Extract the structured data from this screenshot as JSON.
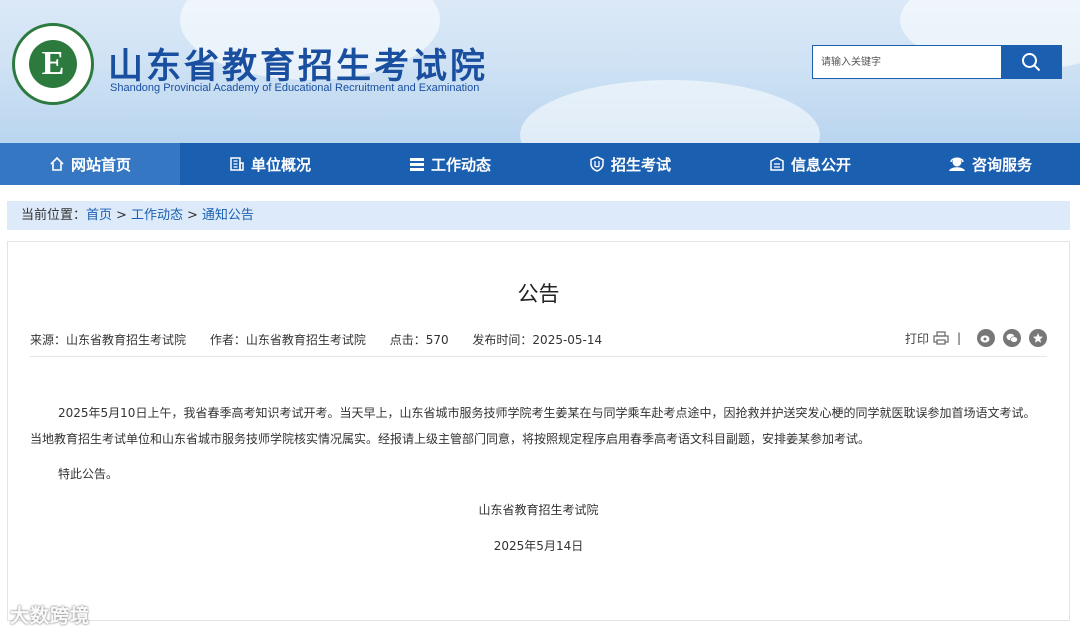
{
  "header": {
    "logo_letter": "E",
    "title": "山东省教育招生考试院",
    "subtitle": "Shandong Provincial Academy of Educational Recruitment and Examination",
    "search_placeholder": "请输入关键字",
    "search_icon": "search-icon"
  },
  "nav": {
    "items": [
      {
        "label": "网站首页",
        "icon": "home-icon",
        "active": true
      },
      {
        "label": "单位概况",
        "icon": "building-icon"
      },
      {
        "label": "工作动态",
        "icon": "list-icon"
      },
      {
        "label": "招生考试",
        "icon": "shield-icon"
      },
      {
        "label": "信息公开",
        "icon": "info-board-icon"
      },
      {
        "label": "咨询服务",
        "icon": "support-icon"
      }
    ]
  },
  "breadcrumb": {
    "prefix": "当前位置：",
    "items": [
      "首页",
      "工作动态",
      "通知公告"
    ],
    "separator": ">"
  },
  "article": {
    "title": "公告",
    "meta": {
      "source": "来源：山东省教育招生考试院",
      "author": "作者：山东省教育招生考试院",
      "clicks": "点击：570",
      "date": "发布时间：2025-05-14"
    },
    "tools": {
      "print": "打印",
      "separator": "|"
    },
    "paragraph1": "2025年5月10日上午，我省春季高考知识考试开考。当天早上，山东省城市服务技师学院考生姜某在与同学乘车赴考点途中，因抢救并护送突发心梗的同学就医耽误参加首场语文考试。当地教育招生考试单位和山东省城市服务技师学院核实情况属实。经报请上级主管部门同意，将按照规定程序启用春季高考语文科目副题，安排姜某参加考试。",
    "paragraph2": "特此公告。",
    "signature": "山东省教育招生考试院",
    "sign_date": "2025年5月14日"
  },
  "watermark": "大数跨境",
  "colors": {
    "nav_bg": "#1a5fb0",
    "nav_active": "#3677c4",
    "title_blue": "#1a4fa0",
    "breadcrumb_bg": "#dceafa"
  }
}
